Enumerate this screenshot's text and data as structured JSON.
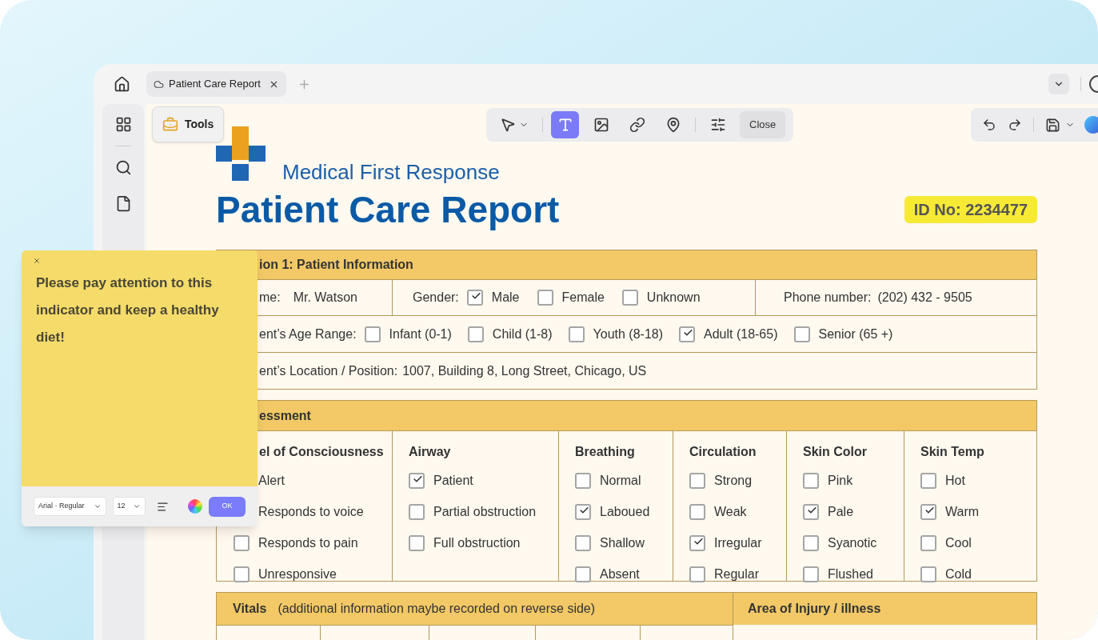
{
  "tab": {
    "title": "Patient Care Report"
  },
  "tools_button": {
    "label": "Tools"
  },
  "toolbar": {
    "tools": [
      {
        "kind": "select",
        "selected": false
      },
      {
        "kind": "text",
        "selected": true
      },
      {
        "kind": "image",
        "selected": false
      },
      {
        "kind": "link",
        "selected": false
      },
      {
        "kind": "pin",
        "selected": false
      },
      {
        "kind": "settings",
        "selected": false
      }
    ],
    "close": "Close"
  },
  "header": {
    "org": "Medical First Response",
    "title": "Patient Care Report",
    "id": "ID No: 2234477"
  },
  "section1": {
    "title": "ion 1: Patient Information",
    "name_label": "me:",
    "name_value": "Mr. Watson",
    "gender_label": "Gender:",
    "gender_options": [
      {
        "label": "Male",
        "checked": true
      },
      {
        "label": "Female",
        "checked": false
      },
      {
        "label": "Unknown",
        "checked": false
      }
    ],
    "phone_label": "Phone number:",
    "phone_value": "(202) 432 - 9505",
    "age_label": "ent’s Age Range:",
    "age_options": [
      {
        "label": "Infant (0-1)",
        "checked": false
      },
      {
        "label": "Child (1-8)",
        "checked": false
      },
      {
        "label": "Youth (8-18)",
        "checked": false
      },
      {
        "label": "Adult (18-65)",
        "checked": true
      },
      {
        "label": "Senior (65 +)",
        "checked": false
      }
    ],
    "location_label": "ent’s Location / Position:",
    "location_value": "1007, Building 8, Long Street, Chicago, US"
  },
  "assessment": {
    "title": "essment",
    "columns": [
      {
        "title": "el of Consciousness",
        "items": [
          {
            "label": "Alert"
          },
          {
            "label": "Responds to voice"
          },
          {
            "label": "Responds to pain",
            "checked": false
          },
          {
            "label": "Unresponsive",
            "checked": false
          }
        ]
      },
      {
        "title": "Airway",
        "items": [
          {
            "label": "Patient",
            "checked": true
          },
          {
            "label": "Partial obstruction",
            "checked": false
          },
          {
            "label": "Full obstruction",
            "checked": false
          }
        ]
      },
      {
        "title": "Breathing",
        "items": [
          {
            "label": "Normal",
            "checked": false
          },
          {
            "label": "Laboued",
            "checked": true
          },
          {
            "label": "Shallow",
            "checked": false
          },
          {
            "label": "Absent",
            "checked": false
          }
        ]
      },
      {
        "title": "Circulation",
        "items": [
          {
            "label": "Strong",
            "checked": false
          },
          {
            "label": "Weak",
            "checked": false
          },
          {
            "label": "Irregular",
            "checked": true
          },
          {
            "label": "Regular",
            "checked": false
          }
        ]
      },
      {
        "title": "Skin Color",
        "items": [
          {
            "label": "Pink",
            "checked": false
          },
          {
            "label": "Pale",
            "checked": true
          },
          {
            "label": "Syanotic",
            "checked": false
          },
          {
            "label": "Flushed",
            "checked": false
          }
        ]
      },
      {
        "title": "Skin Temp",
        "items": [
          {
            "label": "Hot",
            "checked": false
          },
          {
            "label": "Warm",
            "checked": true
          },
          {
            "label": "Cool",
            "checked": false
          },
          {
            "label": "Cold",
            "checked": false
          }
        ]
      }
    ]
  },
  "vitals": {
    "title": "Vitals",
    "note": "(additional information maybe recorded on reverse side)",
    "injury_title": "Area of Injury / illness"
  },
  "note_popup": {
    "text": "Please pay attention to this indicator and keep a healthy diet!",
    "font": "Arial · Regular",
    "size": "12",
    "ok": "OK"
  }
}
